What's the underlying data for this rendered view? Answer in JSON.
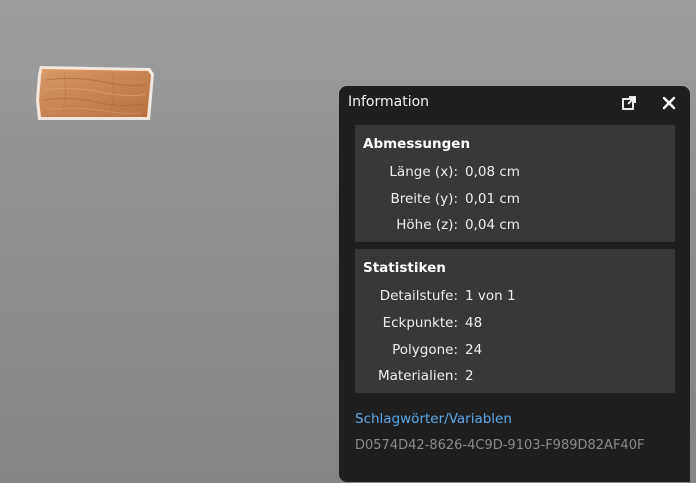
{
  "panel": {
    "title": "Information",
    "icons": {
      "popout": "external-window-icon",
      "close": "close-icon"
    }
  },
  "dimensions": {
    "title": "Abmessungen",
    "rows": [
      {
        "label": "Länge (x):",
        "value": "0,08 cm"
      },
      {
        "label": "Breite (y):",
        "value": "0,01 cm"
      },
      {
        "label": "Höhe (z):",
        "value": "0,04 cm"
      }
    ]
  },
  "statistics": {
    "title": "Statistiken",
    "rows": [
      {
        "label": "Detailstufe:",
        "value": "1 von 1"
      },
      {
        "label": "Eckpunkte:",
        "value": "48"
      },
      {
        "label": "Polygone:",
        "value": "24"
      },
      {
        "label": "Materialien:",
        "value": "2"
      }
    ]
  },
  "tags_link": "Schlagwörter/Variablen",
  "object_id": "D0574D42-8626-4C9D-9103-F989D82AF40F",
  "colors": {
    "panel_bg": "#1f1f1f",
    "section_bg": "#383838",
    "link": "#5aa7e6",
    "viewport_bg": "#8d8f91",
    "wood": "#c98a5a"
  }
}
